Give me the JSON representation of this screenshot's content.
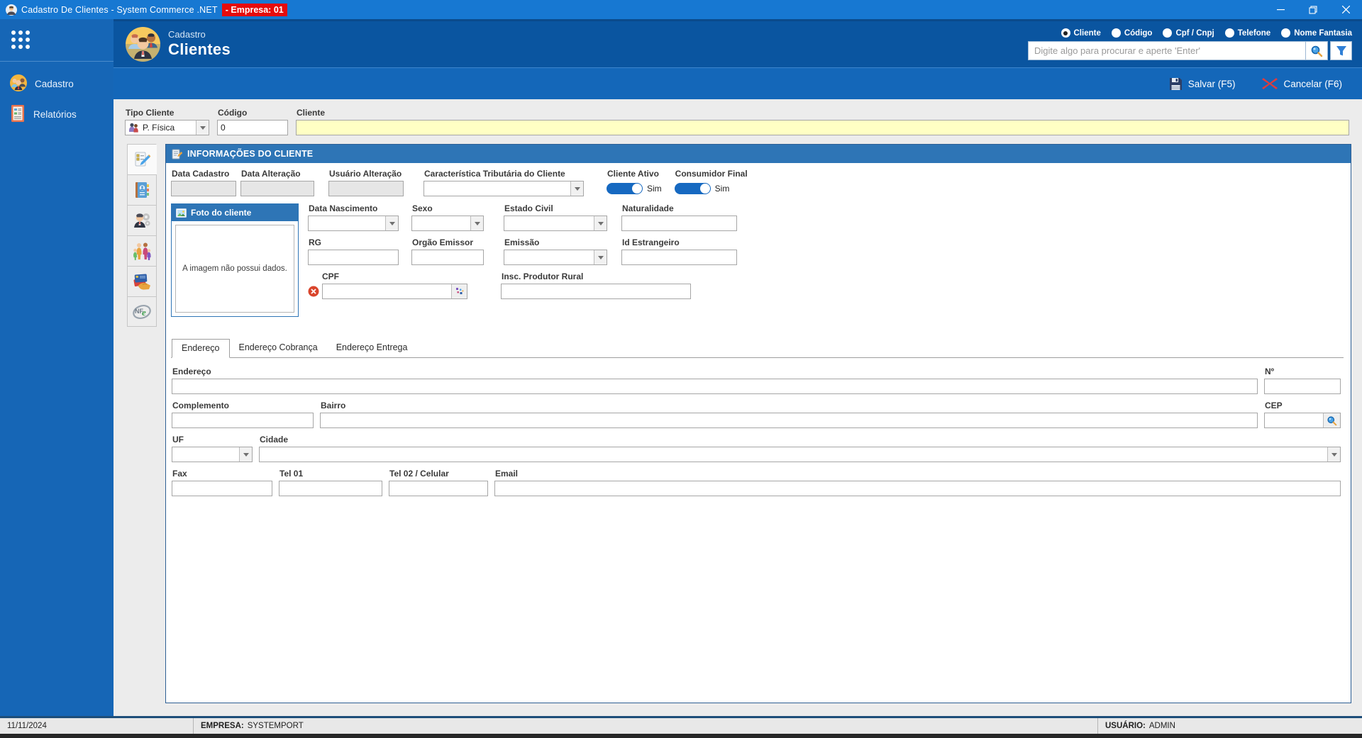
{
  "window": {
    "title": "Cadastro De Clientes - System  Commerce .NET",
    "badge": "- Empresa: 01"
  },
  "sidebar": {
    "items": [
      {
        "label": "Cadastro"
      },
      {
        "label": "Relatórios"
      }
    ]
  },
  "header": {
    "breadcrumb": "Cadastro",
    "title": "Clientes",
    "modes": [
      {
        "label": "Cliente",
        "selected": true
      },
      {
        "label": "Código",
        "selected": false
      },
      {
        "label": "Cpf / Cnpj",
        "selected": false
      },
      {
        "label": "Telefone",
        "selected": false
      },
      {
        "label": "Nome Fantasia",
        "selected": false
      }
    ],
    "search_placeholder": "Digite algo para procurar e aperte 'Enter'"
  },
  "toolbar": {
    "save": "Salvar (F5)",
    "cancel": "Cancelar (F6)"
  },
  "quick": {
    "tipo_label": "Tipo Cliente",
    "tipo_value": "P. Física",
    "codigo_label": "Código",
    "codigo_value": "0",
    "cliente_label": "Cliente"
  },
  "info": {
    "title": "INFORMAÇÕES DO CLIENTE",
    "data_cadastro": "Data Cadastro",
    "data_alteracao": "Data Alteração",
    "usuario_alteracao": "Usuário Alteração",
    "caracteristica": "Característica Tributária do Cliente",
    "cliente_ativo": "Cliente Ativo",
    "cliente_ativo_value": "Sim",
    "consumidor_final": "Consumidor Final",
    "consumidor_final_value": "Sim"
  },
  "photo": {
    "title": "Foto do cliente",
    "empty": "A imagem não possui dados."
  },
  "person": {
    "data_nascimento": "Data Nascimento",
    "sexo": "Sexo",
    "estado_civil": "Estado Civil",
    "naturalidade": "Naturalidade",
    "rg": "RG",
    "orgao_emissor": "Orgão Emissor",
    "emissao": "Emissão",
    "id_estrangeiro": "Id Estrangeiro",
    "cpf": "CPF",
    "insc_produtor": "Insc. Produtor Rural"
  },
  "tabs": [
    {
      "label": "Endereço",
      "active": true
    },
    {
      "label": "Endereço Cobrança",
      "active": false
    },
    {
      "label": "Endereço Entrega",
      "active": false
    }
  ],
  "address": {
    "endereco": "Endereço",
    "numero": "Nº",
    "complemento": "Complemento",
    "bairro": "Bairro",
    "cep": "CEP",
    "uf": "UF",
    "cidade": "Cidade",
    "fax": "Fax",
    "tel01": "Tel 01",
    "tel02": "Tel 02 / Celular",
    "email": "Email"
  },
  "status": {
    "date": "11/11/2024",
    "empresa_label": "EMPRESA:",
    "empresa_value": "SYSTEMPORT",
    "usuario_label": "USUÁRIO:",
    "usuario_value": "ADMIN"
  }
}
